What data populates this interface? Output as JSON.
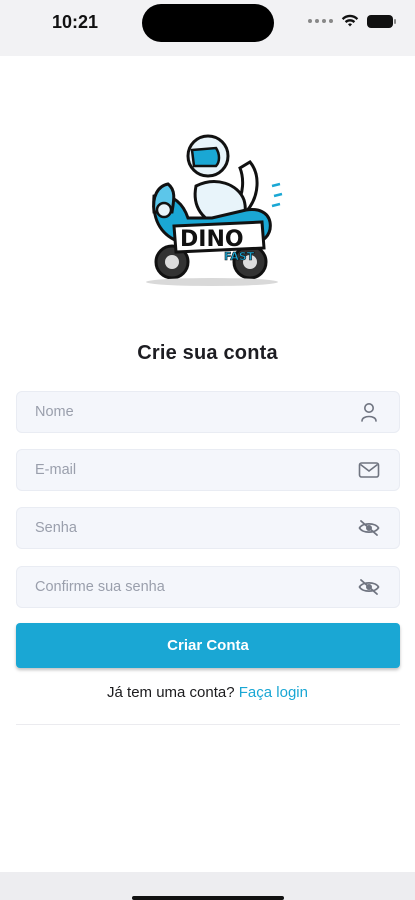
{
  "status_bar": {
    "time": "10:21",
    "icons": [
      "signal-dots-icon",
      "wifi-icon",
      "battery-icon"
    ]
  },
  "logo": {
    "line1": "DINO",
    "line2": "FAST",
    "accent_color": "#1aa7d4"
  },
  "form": {
    "title": "Crie sua conta",
    "fields": [
      {
        "placeholder": "Nome",
        "value": "",
        "icon": "user-icon"
      },
      {
        "placeholder": "E-mail",
        "value": "",
        "icon": "mail-icon"
      },
      {
        "placeholder": "Senha",
        "value": "",
        "icon": "eye-off-icon"
      },
      {
        "placeholder": "Confirme sua senha",
        "value": "",
        "icon": "eye-off-icon"
      }
    ],
    "submit_label": "Criar Conta",
    "login_prompt": "Já tem uma conta?",
    "login_link": "Faça login"
  },
  "colors": {
    "primary": "#1aa7d4",
    "field_bg": "#f4f6fb",
    "placeholder": "#9a9fac"
  }
}
